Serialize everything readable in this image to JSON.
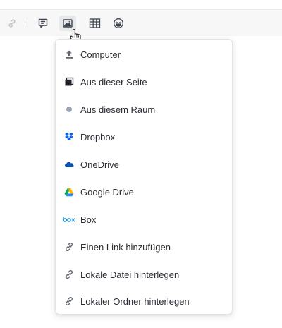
{
  "toolbar": {
    "icons": [
      "link-icon",
      "comment-icon",
      "image-icon",
      "table-icon",
      "emoji-icon"
    ]
  },
  "menu": {
    "items": [
      {
        "label": "Computer",
        "icon": "upload-icon"
      },
      {
        "label": "Aus dieser Seite",
        "icon": "page-icon"
      },
      {
        "label": "Aus diesem Raum",
        "icon": "room-dot-icon"
      },
      {
        "label": "Dropbox",
        "icon": "dropbox-icon"
      },
      {
        "label": "OneDrive",
        "icon": "onedrive-icon"
      },
      {
        "label": "Google Drive",
        "icon": "google-drive-icon"
      },
      {
        "label": "Box",
        "icon": "box-icon"
      },
      {
        "label": "Einen Link hinzufügen",
        "icon": "link-icon"
      },
      {
        "label": "Lokale Datei hinterlegen",
        "icon": "link-icon"
      },
      {
        "label": "Lokaler Ordner hinterlegen",
        "icon": "link-icon"
      }
    ]
  },
  "colors": {
    "toolbar_bg": "#f7f7f8",
    "icon_gray": "#5f6670",
    "dropbox_blue": "#0061fe",
    "onedrive_blue": "#0a4fb0",
    "box_blue": "#1e90d8"
  }
}
